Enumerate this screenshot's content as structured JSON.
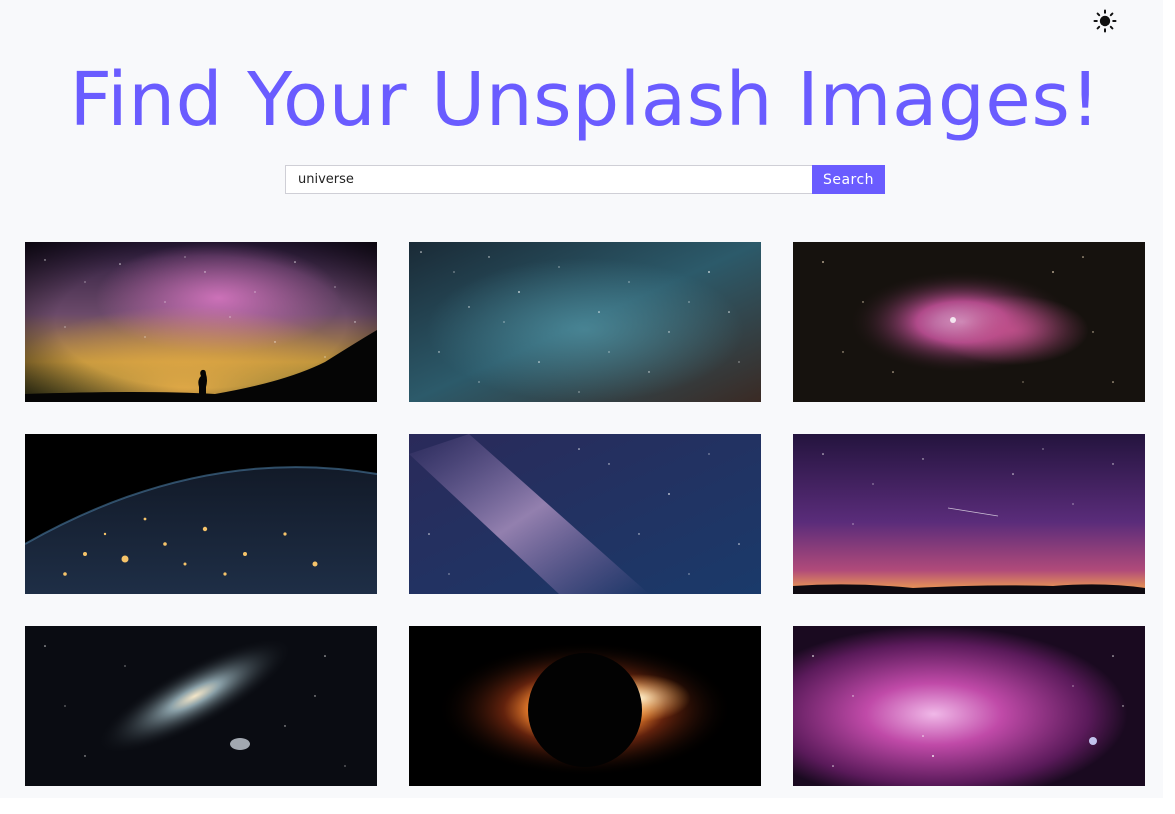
{
  "header": {
    "title": "Find Your Unsplash Images!",
    "theme_toggle_icon": "sun-icon"
  },
  "search": {
    "value": "universe",
    "button_label": "Search"
  },
  "colors": {
    "accent": "#6a5cff",
    "background": "#f8f9fb"
  },
  "gallery": {
    "images": [
      {
        "subject": "milky-way-silhouette"
      },
      {
        "subject": "star-field-blue"
      },
      {
        "subject": "orion-nebula"
      },
      {
        "subject": "earth-night-lights"
      },
      {
        "subject": "milky-way-blue"
      },
      {
        "subject": "purple-night-sky"
      },
      {
        "subject": "andromeda-galaxy"
      },
      {
        "subject": "solar-eclipse"
      },
      {
        "subject": "pink-nebula"
      }
    ]
  }
}
